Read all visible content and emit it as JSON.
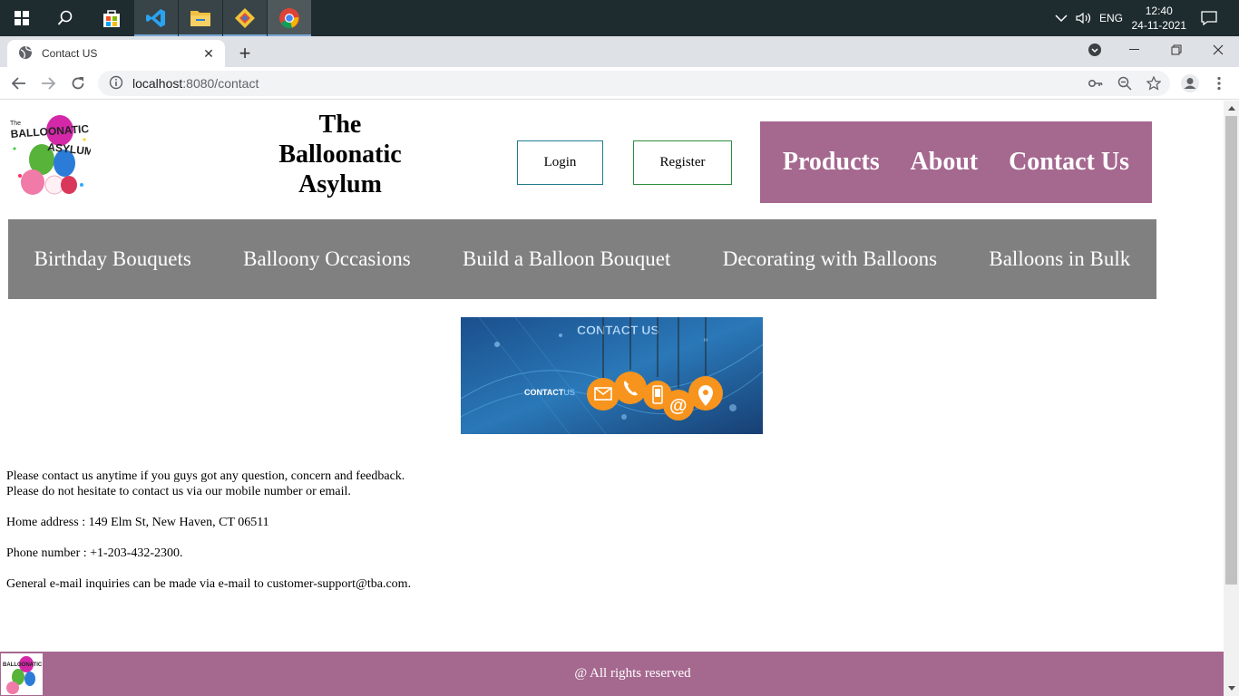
{
  "taskbar": {
    "language": "ENG",
    "time": "12:40",
    "date": "24-11-2021"
  },
  "browser": {
    "tab_title": "Contact US",
    "new_tab_symbol": "+",
    "tab_close_symbol": "✕",
    "url_host": "localhost",
    "url_rest": ":8080/contact"
  },
  "header": {
    "logo_text": "The Balloonatic Asylum",
    "title_line1": "The",
    "title_line2": "Balloonatic",
    "title_line3": "Asylum",
    "login_label": "Login",
    "register_label": "Register"
  },
  "mainnav": {
    "items": [
      "Products",
      "About",
      "Contact Us"
    ]
  },
  "subnav": {
    "items": [
      "Birthday Bouquets",
      "Balloony Occasions",
      "Build a Balloon Bouquet",
      "Decorating with Balloons",
      "Balloons in Bulk"
    ]
  },
  "banner": {
    "heading": "CONTACT US",
    "side_label_bold": "CONTACT",
    "side_label_light": "US"
  },
  "content": {
    "line1": "Please contact us anytime if you guys got any question, concern and feedback.",
    "line2": "Please do not hesitate to contact us via our mobile number or email.",
    "address": "Home address : 149 Elm St, New Haven, CT 06511",
    "phone": "Phone number : +1-203-432-2300.",
    "email": "General e-mail inquiries can be made via e-mail to customer-support@tba.com."
  },
  "footer": {
    "text": "@ All rights reserved"
  },
  "colors": {
    "brand_purple": "#a5688f",
    "subnav_gray": "#808080",
    "taskbar": "#1e2b2f"
  }
}
